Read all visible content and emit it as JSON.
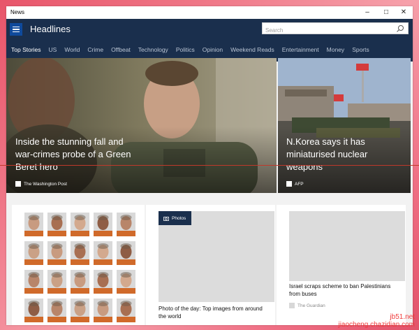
{
  "window": {
    "title": "News",
    "controls": [
      "minimize",
      "maximize",
      "close"
    ]
  },
  "app": {
    "section_title": "Headlines"
  },
  "search": {
    "placeholder": "Search"
  },
  "nav": {
    "items": [
      "Top Stories",
      "US",
      "World",
      "Crime",
      "Offbeat",
      "Technology",
      "Politics",
      "Opinion",
      "Weekend Reads",
      "Entertainment",
      "Money",
      "Sports"
    ]
  },
  "hero_left": {
    "line1": "Inside the stunning fall and",
    "line2": "war-crimes probe of a Green",
    "line3": "Beret hero",
    "source": "The Washington Post"
  },
  "hero_right": {
    "line1": "N.Korea says it has",
    "line2": "miniaturised nuclear",
    "line3": "weapons",
    "source": "AFP"
  },
  "card_middle": {
    "badge": "Photos",
    "caption1": "Photo of the day: Top images from around",
    "caption2": "the world"
  },
  "card_right": {
    "caption1": "Israel scraps scheme to ban Palestinians",
    "caption2": "from buses",
    "source": "The Guardian"
  },
  "watermark": {
    "line1": "jb51.net",
    "line2": "jiaocheng.chazidian.com"
  },
  "colors": {
    "accent": "#1a2f4d",
    "hamburger": "#0f4a9c"
  }
}
